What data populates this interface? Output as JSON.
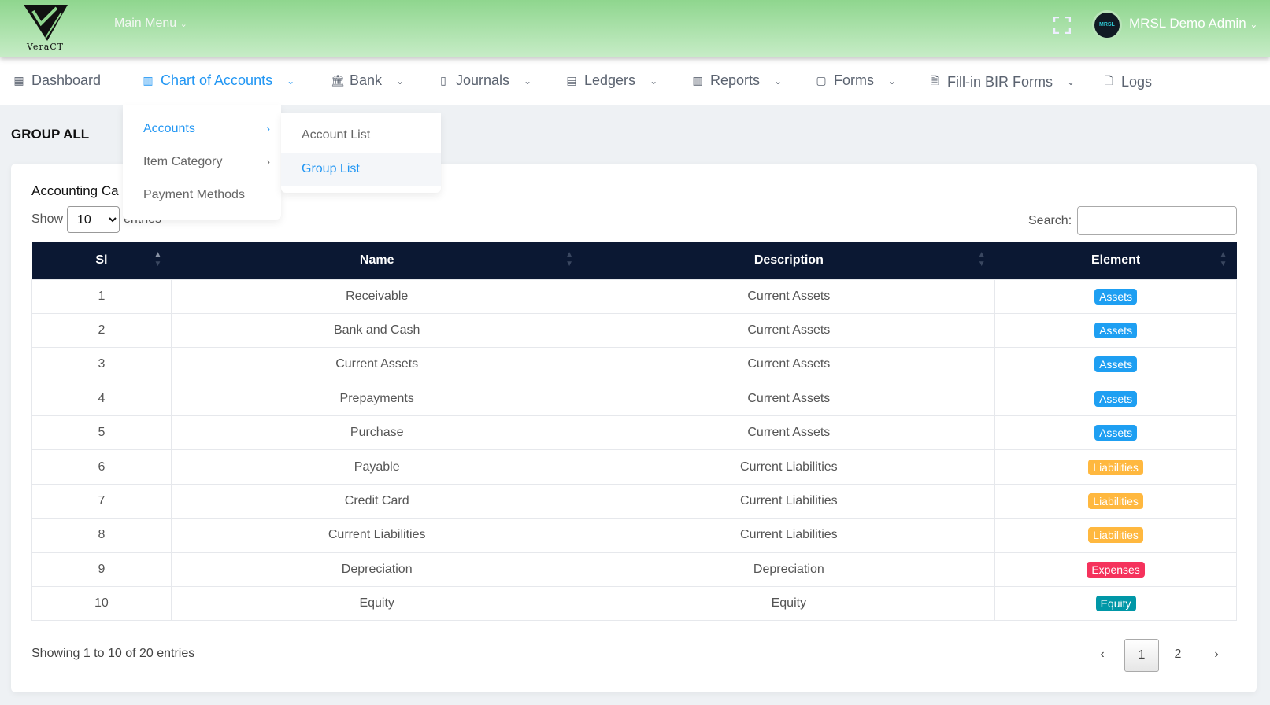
{
  "header": {
    "logo_text": "VeraCT",
    "main_menu": "Main Menu",
    "user_name": "MRSL Demo Admin",
    "avatar_text": "MRSL"
  },
  "nav": [
    {
      "label": "Dashboard",
      "icon": "dashboard-icon"
    },
    {
      "label": "Chart of Accounts",
      "icon": "chart-icon",
      "active": true
    },
    {
      "label": "Bank",
      "icon": "bank-icon"
    },
    {
      "label": "Journals",
      "icon": "journal-icon"
    },
    {
      "label": "Ledgers",
      "icon": "ledger-icon"
    },
    {
      "label": "Reports",
      "icon": "report-icon"
    },
    {
      "label": "Forms",
      "icon": "clipboard-icon"
    },
    {
      "label": "Fill-in BIR Forms",
      "icon": "document-icon"
    },
    {
      "label": "Logs",
      "icon": "log-icon"
    }
  ],
  "dropdown": {
    "items": [
      "Accounts",
      "Item Category",
      "Payment Methods"
    ],
    "submenu": [
      "Account List",
      "Group List"
    ]
  },
  "page": {
    "title": "GROUP ALL",
    "card_title": "Accounting Ca",
    "show": "Show",
    "entries": "entries",
    "length": "10",
    "search_label": "Search:",
    "search_value": ""
  },
  "table": {
    "headers": [
      "Sl",
      "Name",
      "Description",
      "Element"
    ],
    "rows": [
      [
        "1",
        "Receivable",
        "Current Assets",
        "Assets"
      ],
      [
        "2",
        "Bank and Cash",
        "Current Assets",
        "Assets"
      ],
      [
        "3",
        "Current Assets",
        "Current Assets",
        "Assets"
      ],
      [
        "4",
        "Prepayments",
        "Current Assets",
        "Assets"
      ],
      [
        "5",
        "Purchase",
        "Current Assets",
        "Assets"
      ],
      [
        "6",
        "Payable",
        "Current Liabilities",
        "Liabilities"
      ],
      [
        "7",
        "Credit Card",
        "Current Liabilities",
        "Liabilities"
      ],
      [
        "8",
        "Current Liabilities",
        "Current Liabilities",
        "Liabilities"
      ],
      [
        "9",
        "Depreciation",
        "Depreciation",
        "Expenses"
      ],
      [
        "10",
        "Equity",
        "Equity",
        "Equity"
      ]
    ]
  },
  "badge_colors": {
    "Assets": "#1e9ff2",
    "Liabilities": "#ffb83f",
    "Expenses": "#f5325c",
    "Equity": "#0097a7"
  },
  "footer": {
    "info": "Showing 1 to 10 of 20 entries",
    "prev": "‹",
    "pages": [
      "1",
      "2"
    ],
    "next": "›",
    "current_page": "1"
  }
}
